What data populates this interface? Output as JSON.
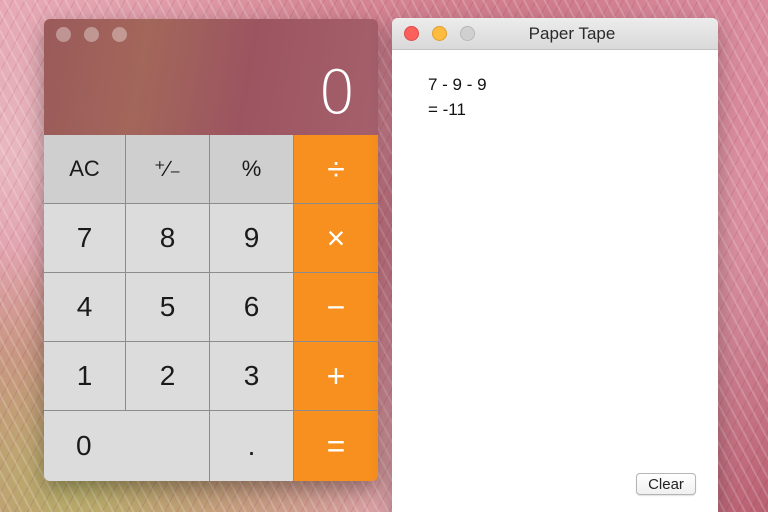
{
  "calculator": {
    "display": "0",
    "keys": {
      "ac": "AC",
      "plus_minus": "⁺∕₋",
      "percent": "%",
      "divide": "÷",
      "seven": "7",
      "eight": "8",
      "nine": "9",
      "multiply": "×",
      "four": "4",
      "five": "5",
      "six": "6",
      "minus": "−",
      "one": "1",
      "two": "2",
      "three": "3",
      "plus": "+",
      "zero": "0",
      "decimal": ".",
      "equals": "="
    },
    "colors": {
      "operator": "#f7901e",
      "key": "#dcdcdc"
    }
  },
  "paper_tape": {
    "title": "Paper Tape",
    "lines": [
      "7 - 9 - 9",
      "= -11"
    ],
    "clear_label": "Clear",
    "traffic_lights": {
      "close": "#fc605c",
      "minimize": "#fdbc40",
      "zoom": "#d0d0d0"
    }
  }
}
